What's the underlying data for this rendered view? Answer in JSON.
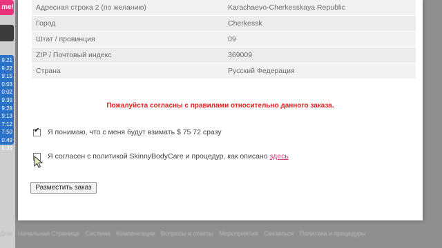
{
  "sidebar": {
    "badge_text": "me!",
    "times": [
      "9:21",
      "9:22",
      "9:15",
      "0:03",
      "0:02",
      "9:39",
      "9:28",
      "9:13",
      "7:12",
      "7:50",
      "0:49",
      "6:35"
    ]
  },
  "address": {
    "rows": [
      {
        "label": "Адресная строка 2 (по желанию)",
        "value": "Karachaevo-Cherkesskaya Republic"
      },
      {
        "label": "Город",
        "value": "Cherkessk"
      },
      {
        "label": "Штат / провинция",
        "value": "09"
      },
      {
        "label": "ZIP / Почтовый индекс",
        "value": "369009"
      },
      {
        "label": "Страна",
        "value": "Русский Федерация"
      }
    ]
  },
  "order": {
    "agree_message": "Пожалуйста согласны с правилами относительно данного заказа.",
    "charge_checkbox_label": "Я понимаю, что с меня будут взимать $ 75 72 сразу",
    "policy_checkbox_label": "Я согласен с политикой SkinnyBodyCare и процедур, как описано",
    "policy_link": "здесь",
    "place_order_button": "Разместить заказ"
  },
  "footer": {
    "links": [
      "Дом",
      "Начальная Страница",
      "Система",
      "Компенсации",
      "Вопросы и ответы",
      "Мероприятия",
      "Связаться",
      "Политика и процедуры"
    ]
  },
  "colors": {
    "warning": "#e02020",
    "link": "#d2417a",
    "sidebar_blue": "#2a72c8",
    "badge_pink": "#e8347a"
  }
}
